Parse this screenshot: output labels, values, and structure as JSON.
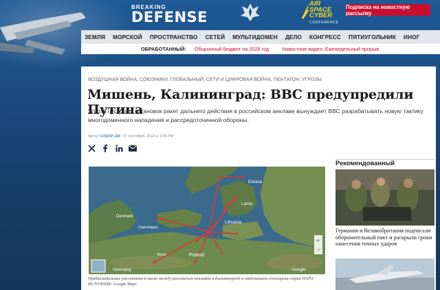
{
  "header": {
    "logo_small": "BREAKING",
    "logo_big": "DEFENSE",
    "conference_logo": [
      "AIR",
      "SPACE",
      "CYBER"
    ],
    "conference_sub": "CONFERENCE",
    "subscribe_label": "Подписка на новостную рассылку"
  },
  "nav": {
    "items": [
      "ЗЕМЛЯ",
      "МОРСКОЙ",
      "ПРОСТРАНСТВО",
      "СЕТЕЙ",
      "МУЛЬТИДОМЕН",
      "ДЕЛО",
      "КОНГРЕСС",
      "ПЯТИУГОЛЬНИК",
      "ИНОГ"
    ]
  },
  "featured": {
    "label": "ОБРАБОТАННЫЙ:",
    "link1": "Оборонный бюджет на 2026 год",
    "link2": "Новостное видео: Еженедельный прорыв"
  },
  "article": {
    "tags": "ВОЗДУШНАЯ ВОЙНА, СОЮЗНИКИ, ГЛОБАЛЬНЫЙ, СЕТИ И ЦИФРОВАЯ ВОЙНА, ПЕНТАГОН, УГРОЗЫ",
    "title": "Мишень, Калининград: ВВС предупредили Путина",
    "lead": "Угроза пусковых установок ракет дальнего действия в российском анклаве вынуждает ВВС разрабатывать новую тактику многодоменного нападения и рассредоточенной обороны.",
    "byline_prefix": "Автор",
    "author": "СИДНИ ДЖ.",
    "date": "17 сентября, 2019 в 1:06 PM",
    "map_labels": {
      "estonia": "Estonia",
      "latvia": "Latvia",
      "lithuania": "Lithuania",
      "denmark": "Denmark",
      "poland": "Poland",
      "germany": "Germany",
      "copenhagen": "Copenhagen",
      "berlin": "Berlin",
      "google": "Google"
    },
    "caption": "Приблизительные расстояния в милях между российским анклавом в Калининграде и отдельными столицами стран НАТО. ИСТОЧНИК: Google Maps"
  },
  "sidebar": {
    "title": "Рекомендованный",
    "item1": "Германия и Великобритания подписали оборонительный пакт и раскрыли сроки нанесения точных ударов"
  },
  "colors": {
    "brand_red": "#c8102e",
    "header_blue": "#1b4d82",
    "nav_bg": "#e3e6ea",
    "link_blue": "#2d5fa0",
    "asc_yellow": "#f7d51a"
  },
  "icons": [
    "x-icon",
    "facebook-icon",
    "linkedin-icon",
    "email-icon",
    "wing-emblem-icon"
  ]
}
